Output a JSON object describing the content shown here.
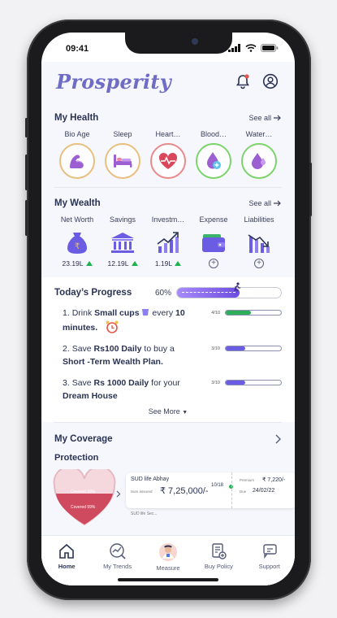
{
  "status": {
    "time": "09:41"
  },
  "header": {
    "logo": "Prosperity",
    "icons": [
      "bell-icon",
      "profile-icon"
    ]
  },
  "health": {
    "title": "My Health",
    "see_all": "See all",
    "items": [
      {
        "label": "Bio Age",
        "icon": "arm-muscle-icon",
        "ring": "#e8c07d"
      },
      {
        "label": "Sleep",
        "icon": "bed-icon",
        "ring": "#e8c07d"
      },
      {
        "label": "Heart…",
        "icon": "heart-pulse-icon",
        "ring": "#e98a8a"
      },
      {
        "label": "Blood…",
        "icon": "blood-drop-icon",
        "ring": "#7bd46a"
      },
      {
        "label": "Water…",
        "icon": "water-drop-icon",
        "ring": "#7bd46a"
      }
    ]
  },
  "wealth": {
    "title": "My Wealth",
    "see_all": "See all",
    "items": [
      {
        "label": "Net Worth",
        "icon": "money-bag-icon",
        "value": "23.19L"
      },
      {
        "label": "Savings",
        "icon": "bank-icon",
        "value": "12.19L"
      },
      {
        "label": "Investm…",
        "icon": "growth-chart-icon",
        "value": "1.19L"
      },
      {
        "label": "Expense",
        "icon": "wallet-icon",
        "value": ""
      },
      {
        "label": "Liabilities",
        "icon": "declining-chart-icon",
        "value": ""
      }
    ]
  },
  "progress": {
    "title": "Today’s Progress",
    "percent_label": "60%",
    "percent": 0.6,
    "see_more": "See More",
    "tasks": [
      {
        "num": "1.",
        "pre": "Drink ",
        "bold": "Small cups",
        "mid": " every ",
        "bold2": "10 minutes.",
        "post": "",
        "frac": "4/10",
        "level": 0.45,
        "color": "#2fae5a"
      },
      {
        "num": "2.",
        "pre": "Save ",
        "bold": "Rs100 Daily",
        "mid": " to buy a ",
        "bold2": "Short -Term Wealth Plan.",
        "post": "",
        "frac": "3/10",
        "level": 0.35,
        "color": "#6b5de3"
      },
      {
        "num": "3.",
        "pre": "Save ",
        "bold": "Rs 1000 Daily",
        "mid": " for your ",
        "bold2": "Dream House",
        "post": "",
        "frac": "3/10",
        "level": 0.35,
        "color": "#6b5de3"
      }
    ]
  },
  "coverage": {
    "title": "My Coverage",
    "protection_title": "Protection",
    "heart_lines": [
      "Covered 38%",
      "Covered 99%"
    ],
    "policy": {
      "name": "SUD life Abhay",
      "sum_label": "Sum assured",
      "sum": "₹ 7,25,000/-",
      "term": "10/18",
      "premium_label": "Premium",
      "premium": "₹ 7,220/-",
      "due_label": "Due",
      "due": "24/02/22",
      "next_name": "SUD life Sec..."
    }
  },
  "tabs": [
    {
      "label": "Home",
      "icon": "home-icon",
      "active": true
    },
    {
      "label": "My Trends",
      "icon": "trends-icon",
      "active": false
    },
    {
      "label": "Measure",
      "icon": "doctor-avatar-icon",
      "active": false
    },
    {
      "label": "Buy Policy",
      "icon": "policy-add-icon",
      "active": false
    },
    {
      "label": "Support",
      "icon": "support-chat-icon",
      "active": false
    }
  ]
}
